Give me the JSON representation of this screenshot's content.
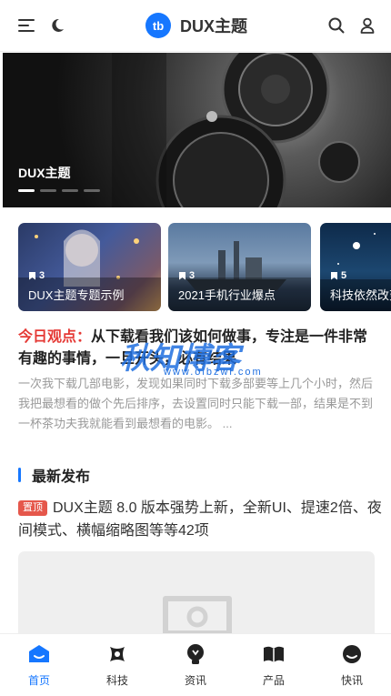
{
  "header": {
    "logo_badge": "tb",
    "logo_text": "DUX主题",
    "icons": [
      "menu-icon",
      "moon-icon",
      "search-icon",
      "user-icon"
    ]
  },
  "banner": {
    "title": "DUX主题",
    "slides": 4,
    "active_slide": 1
  },
  "cards": [
    {
      "count": "3",
      "caption": "DUX主题专题示例"
    },
    {
      "count": "3",
      "caption": "2021手机行业爆点"
    },
    {
      "count": "5",
      "caption": "科技依然改变"
    }
  ],
  "viewpoint": {
    "tag": "今日观点：",
    "title": "从下载看我们该如何做事，专注是一件非常有趣的事情，一旦开头，必有结果",
    "desc": "一次我下载几部电影，发现如果同时下载多部要等上几个小时，然后我把最想看的做个先后排序，去设置同时只能下载一部，结果是不到一杯茶功夫我就能看到最想看的电影。 ..."
  },
  "watermark": {
    "text": "秋知博客",
    "sub": "www.oibzwl.com"
  },
  "section": {
    "title": "最新发布"
  },
  "post": {
    "tag": "置顶",
    "title": "DUX主题 8.0 版本强势上新，全新UI、提速2倍、夜间模式、横幅缩略图等等42项"
  },
  "tabbar": {
    "items": [
      {
        "label": "首页",
        "icon": "home-icon",
        "active": true
      },
      {
        "label": "科技",
        "icon": "tech-icon",
        "active": false
      },
      {
        "label": "资讯",
        "icon": "news-icon",
        "active": false
      },
      {
        "label": "产品",
        "icon": "product-icon",
        "active": false
      },
      {
        "label": "快讯",
        "icon": "flash-icon",
        "active": false
      }
    ]
  },
  "colors": {
    "accent": "#1677ff",
    "tag_red": "#e5574b",
    "view_tag": "#e53935"
  }
}
